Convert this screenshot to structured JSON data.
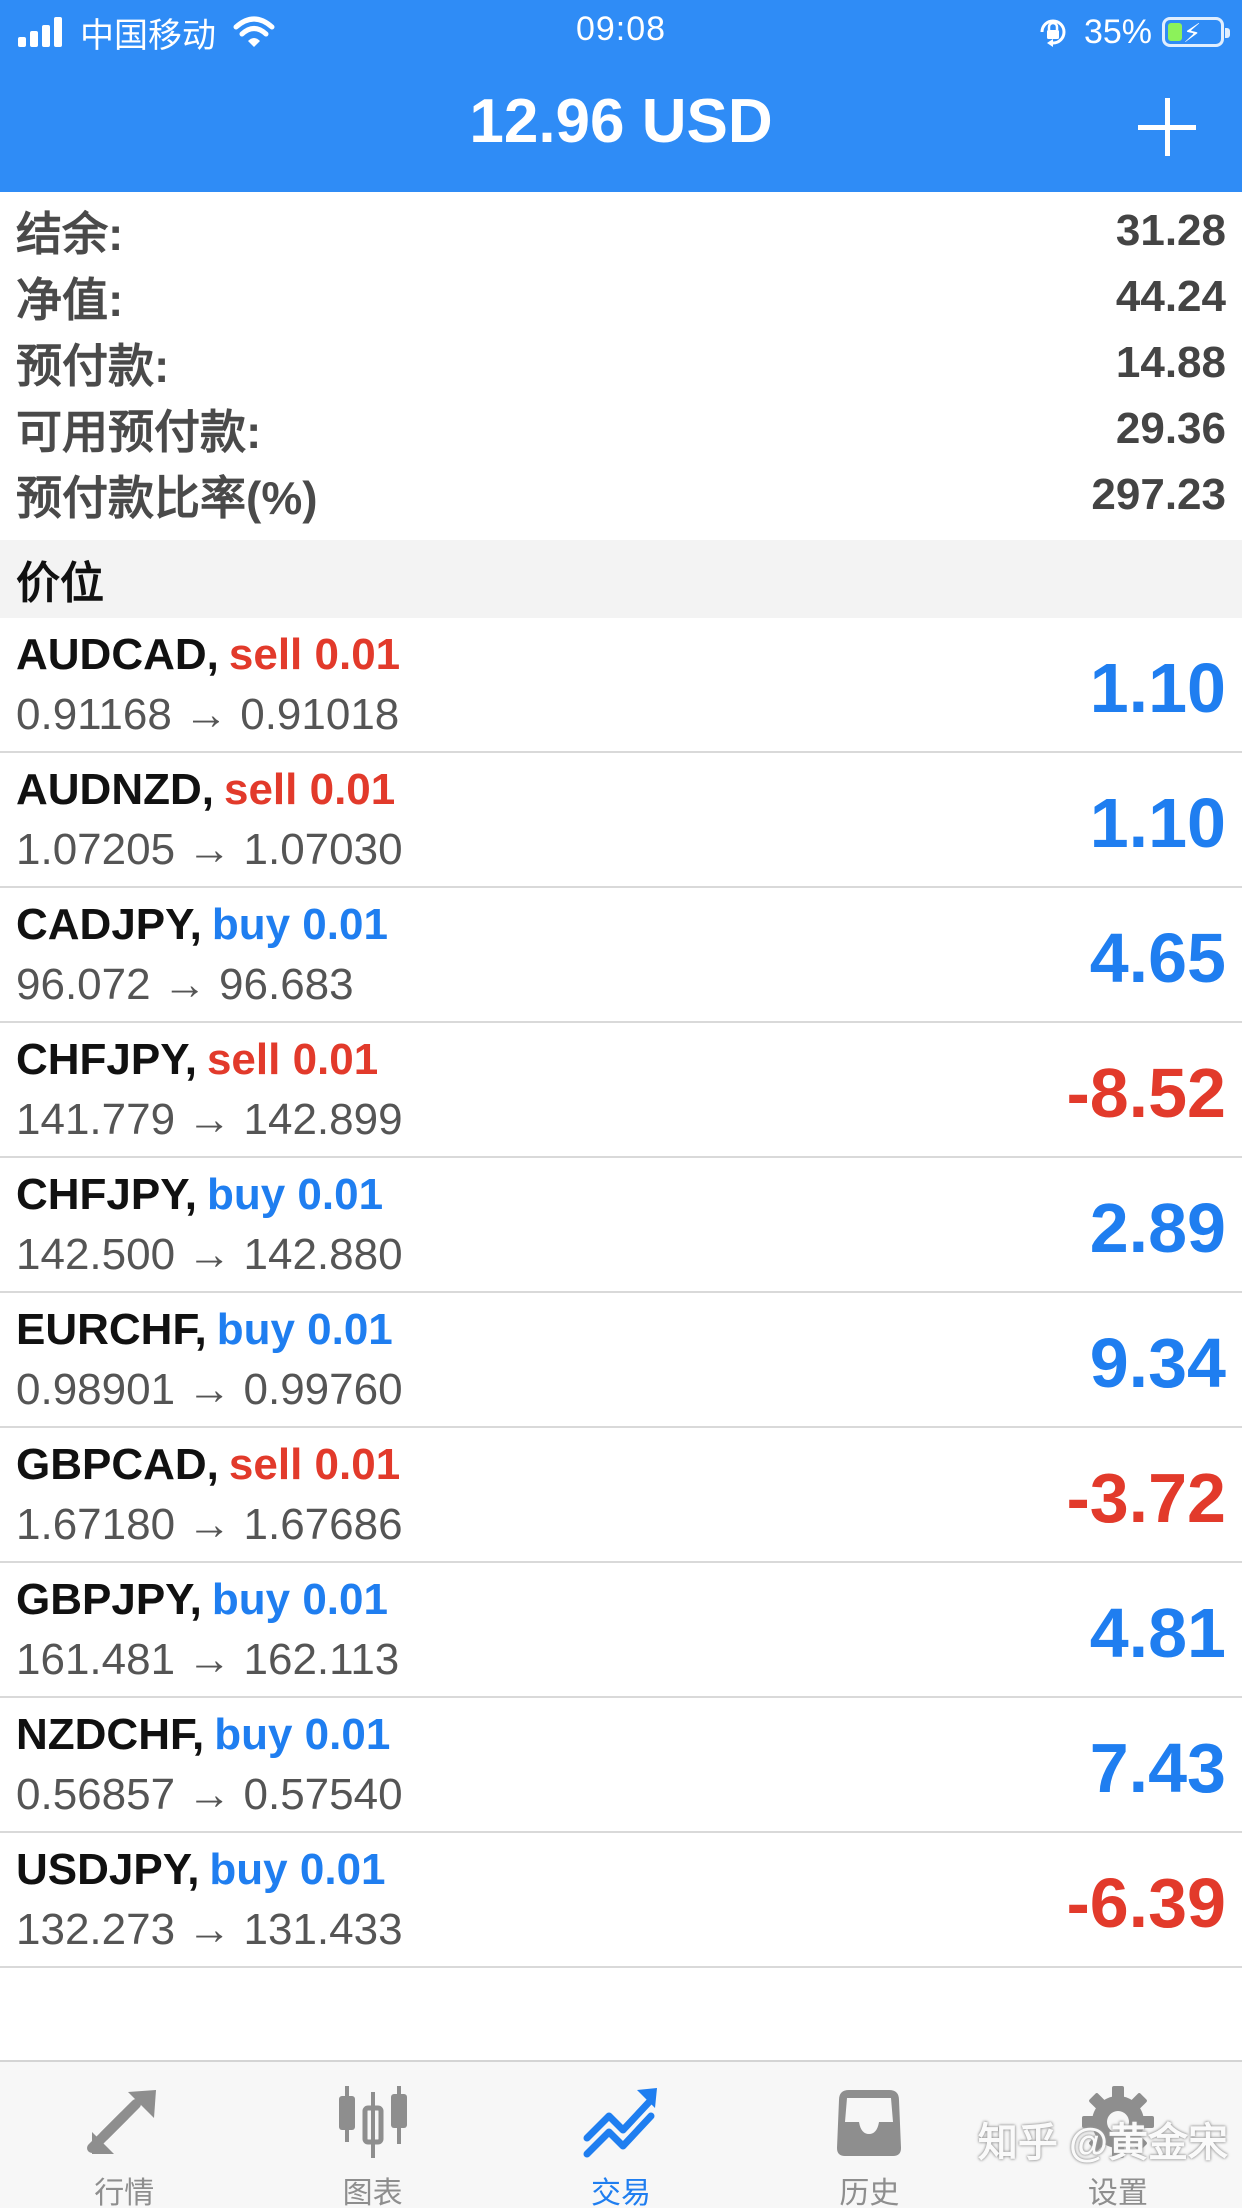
{
  "status_bar": {
    "carrier": "中国移动",
    "time": "09:08",
    "battery_percent": "35%",
    "battery_level": 0.35
  },
  "header": {
    "title": "12.96 USD",
    "add_icon": "plus-icon"
  },
  "summary": [
    {
      "label": "结余:",
      "value": "31.28"
    },
    {
      "label": "净值:",
      "value": "44.24"
    },
    {
      "label": "预付款:",
      "value": "14.88"
    },
    {
      "label": "可用预付款:",
      "value": "29.36"
    },
    {
      "label": "预付款比率(%)",
      "value": "297.23"
    }
  ],
  "section": {
    "title": "价位"
  },
  "positions": [
    {
      "symbol": "AUDCAD,",
      "side": "sell 0.01",
      "prices": "0.91168 → 0.91018",
      "profit": "1.10",
      "side_type": "sell",
      "profit_type": "buy"
    },
    {
      "symbol": "AUDNZD,",
      "side": "sell 0.01",
      "prices": "1.07205 → 1.07030",
      "profit": "1.10",
      "side_type": "sell",
      "profit_type": "buy"
    },
    {
      "symbol": "CADJPY,",
      "side": "buy 0.01",
      "prices": "96.072 → 96.683",
      "profit": "4.65",
      "side_type": "buy",
      "profit_type": "buy"
    },
    {
      "symbol": "CHFJPY,",
      "side": "sell 0.01",
      "prices": "141.779 → 142.899",
      "profit": "-8.52",
      "side_type": "sell",
      "profit_type": "sell"
    },
    {
      "symbol": "CHFJPY,",
      "side": "buy 0.01",
      "prices": "142.500 → 142.880",
      "profit": "2.89",
      "side_type": "buy",
      "profit_type": "buy"
    },
    {
      "symbol": "EURCHF,",
      "side": "buy 0.01",
      "prices": "0.98901 → 0.99760",
      "profit": "9.34",
      "side_type": "buy",
      "profit_type": "buy"
    },
    {
      "symbol": "GBPCAD,",
      "side": "sell 0.01",
      "prices": "1.67180 → 1.67686",
      "profit": "-3.72",
      "side_type": "sell",
      "profit_type": "sell"
    },
    {
      "symbol": "GBPJPY,",
      "side": "buy 0.01",
      "prices": "161.481 → 162.113",
      "profit": "4.81",
      "side_type": "buy",
      "profit_type": "buy"
    },
    {
      "symbol": "NZDCHF,",
      "side": "buy 0.01",
      "prices": "0.56857 → 0.57540",
      "profit": "7.43",
      "side_type": "buy",
      "profit_type": "buy"
    },
    {
      "symbol": "USDJPY,",
      "side": "buy 0.01",
      "prices": "132.273 → 131.433",
      "profit": "-6.39",
      "side_type": "buy",
      "profit_type": "sell"
    }
  ],
  "tabs": [
    {
      "label": "行情",
      "icon": "quotes-arrows-icon",
      "active": false
    },
    {
      "label": "图表",
      "icon": "candlestick-chart-icon",
      "active": false
    },
    {
      "label": "交易",
      "icon": "trade-trend-icon",
      "active": true
    },
    {
      "label": "历史",
      "icon": "history-inbox-icon",
      "active": false
    },
    {
      "label": "设置",
      "icon": "gear-icon",
      "active": false
    }
  ],
  "watermark": "知乎 @黄金宋",
  "colors": {
    "header_bg": "#2f8cf6",
    "sell": "#e23a2b",
    "buy": "#1f7ef0",
    "tab_inactive": "#8e8e8e"
  }
}
